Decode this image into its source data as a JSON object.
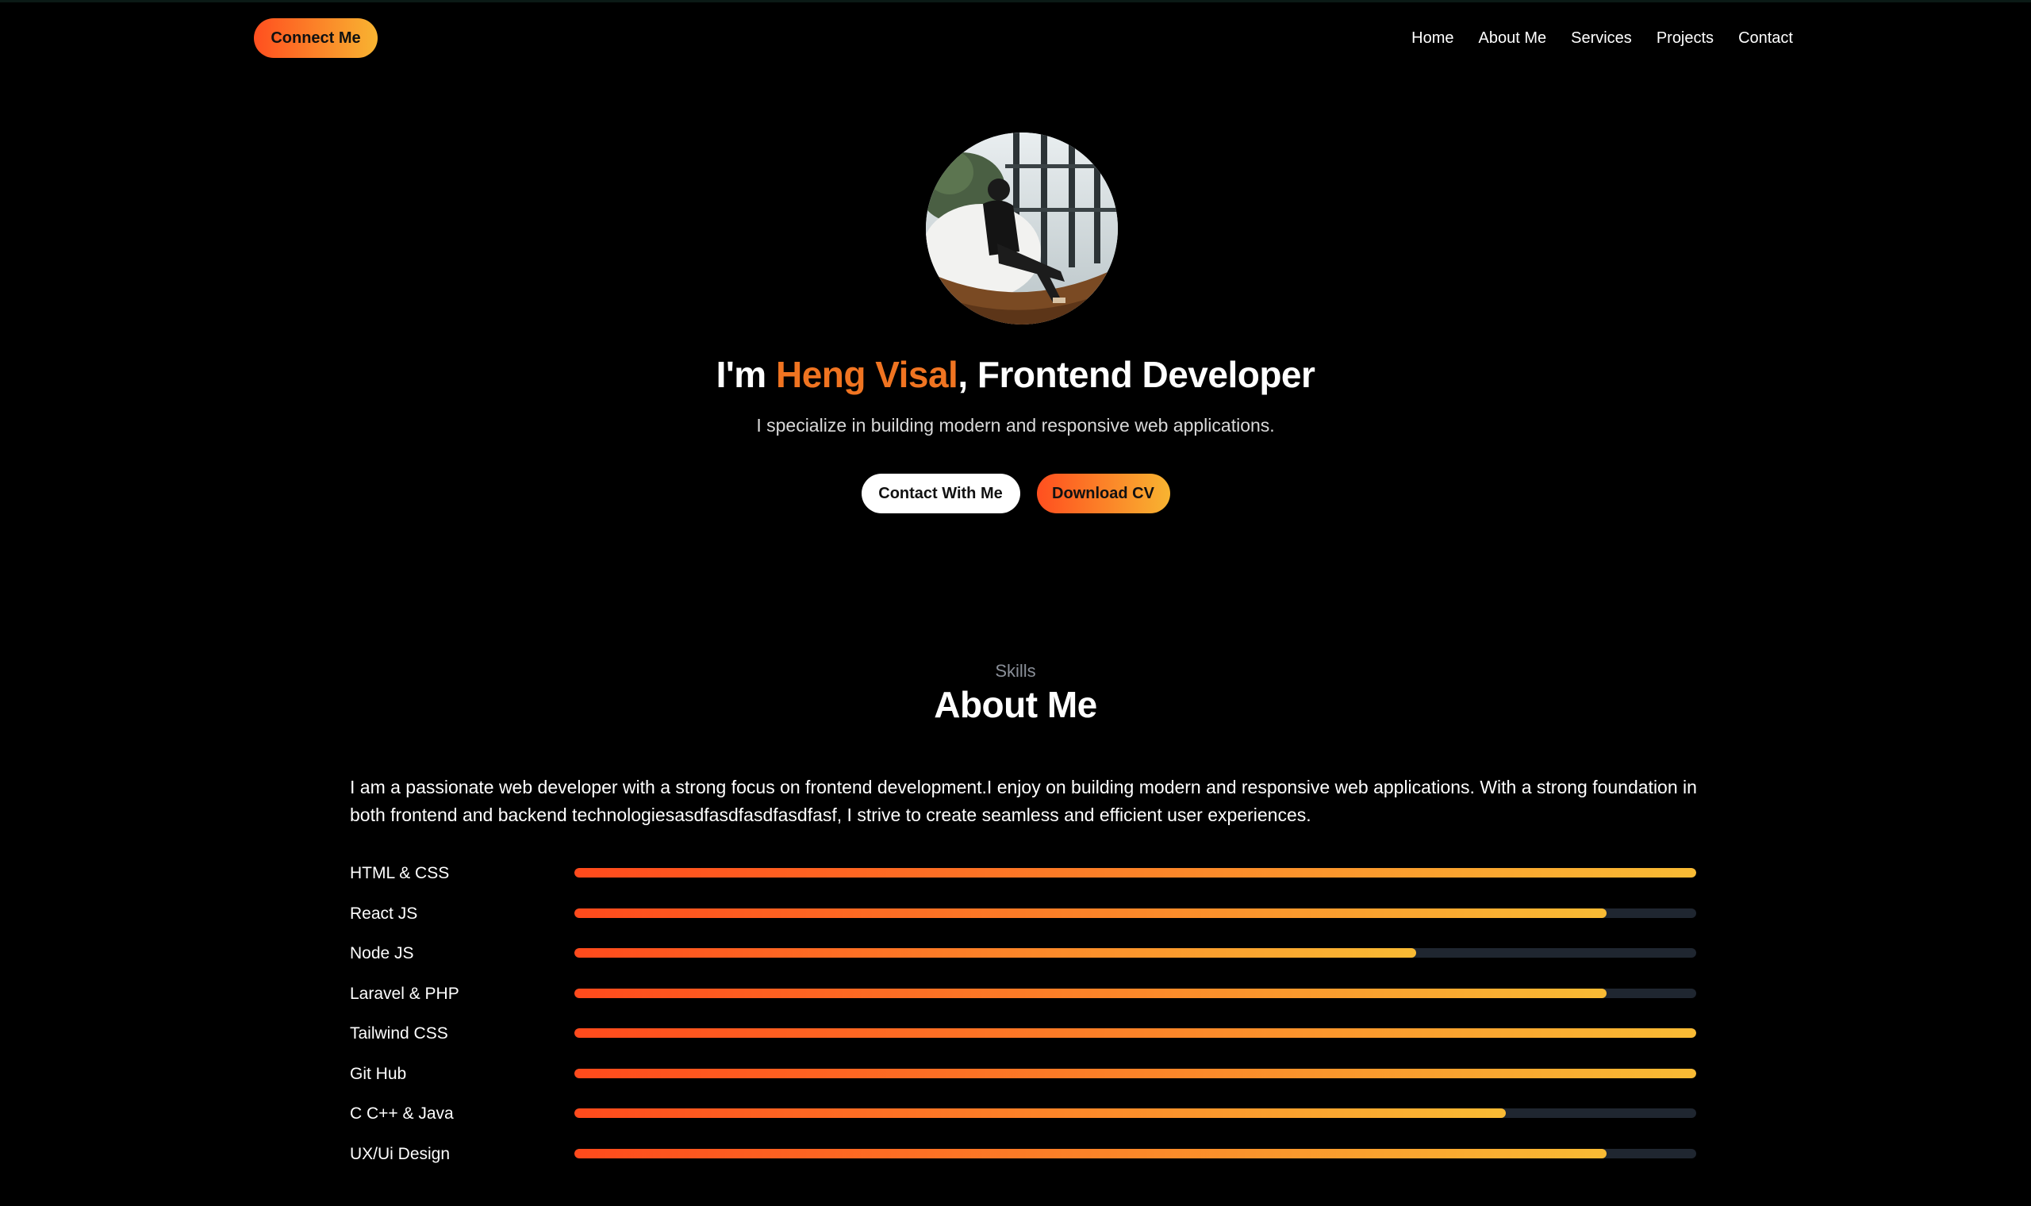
{
  "nav": {
    "connect_label": "Connect Me",
    "links": [
      "Home",
      "About Me",
      "Services",
      "Projects",
      "Contact"
    ]
  },
  "hero": {
    "title_prefix": "I'm ",
    "name": "Heng Visal",
    "title_suffix": ", Frontend Developer",
    "subtitle": "I specialize in building modern and responsive web applications.",
    "contact_button": "Contact With Me",
    "download_button": "Download CV"
  },
  "about": {
    "eyebrow": "Skills",
    "title": "About Me",
    "text": "I am a passionate web developer with a strong focus on frontend development.I enjoy on building modern and responsive web applications. With a strong foundation in both frontend and backend technologiesasdfasdfasdfasdfasf, I strive to create seamless and efficient user experiences."
  },
  "skills": [
    {
      "label": "HTML & CSS",
      "percent": 100
    },
    {
      "label": "React JS",
      "percent": 92
    },
    {
      "label": "Node JS",
      "percent": 75
    },
    {
      "label": "Laravel & PHP",
      "percent": 92
    },
    {
      "label": "Tailwind CSS",
      "percent": 100
    },
    {
      "label": "Git Hub",
      "percent": 100
    },
    {
      "label": "C C++ & Java",
      "percent": 83
    },
    {
      "label": "UX/Ui Design",
      "percent": 92
    }
  ],
  "colors": {
    "accent": "#f07421",
    "gradient_start": "#ff4a1c",
    "gradient_end": "#f9bb34",
    "background": "#000000"
  }
}
